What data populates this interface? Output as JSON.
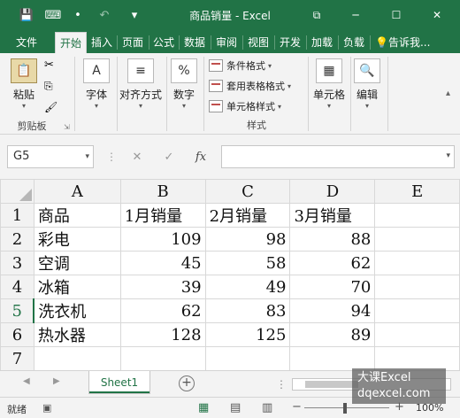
{
  "titlebar": {
    "title": "商品销量 - Excel",
    "save_icon": "💾",
    "touch_icon": "⌨",
    "dot": "•",
    "undo_icon": "↶",
    "customize_icon": "▾",
    "ribbon_display_icon": "⧉",
    "minimize_icon": "─",
    "restore_icon": "☐",
    "close_icon": "✕"
  },
  "tabs": [
    {
      "label": "文件"
    },
    {
      "label": "开始"
    },
    {
      "label": "插入"
    },
    {
      "label": "页面"
    },
    {
      "label": "公式"
    },
    {
      "label": "数据"
    },
    {
      "label": "审阅"
    },
    {
      "label": "视图"
    },
    {
      "label": "开发"
    },
    {
      "label": "加载"
    },
    {
      "label": "负载"
    },
    {
      "label": "告诉我..."
    }
  ],
  "ribbon": {
    "paste_label": "粘贴",
    "paste_caret": "▾",
    "clipboard_label": "剪贴板",
    "font_label": "字体",
    "alignment_label": "对齐方式",
    "number_label": "数字",
    "conditional_format_label": "条件格式",
    "table_format_label": "套用表格格式",
    "cell_style_label": "单元格样式",
    "styles_group_label": "样式",
    "cells_label": "单元格",
    "editing_label": "编辑",
    "dropdown_caret": "▾",
    "font_glyph": "A",
    "number_glyph": "%",
    "align_glyph": "≡"
  },
  "formula_bar": {
    "name_box": "G5",
    "cancel_glyph": "✕",
    "enter_glyph": "✓",
    "fx_glyph": "fx",
    "dropdown_caret": "▾",
    "formula_value": ""
  },
  "sheet": {
    "columns": [
      "A",
      "B",
      "C",
      "D",
      "E"
    ],
    "rows": [
      {
        "num": "1",
        "cells": [
          "商品",
          "1月销量",
          "2月销量",
          "3月销量",
          ""
        ]
      },
      {
        "num": "2",
        "cells": [
          "彩电",
          "109",
          "98",
          "88",
          ""
        ]
      },
      {
        "num": "3",
        "cells": [
          "空调",
          "45",
          "58",
          "62",
          ""
        ]
      },
      {
        "num": "4",
        "cells": [
          "冰箱",
          "39",
          "49",
          "70",
          ""
        ]
      },
      {
        "num": "5",
        "cells": [
          "洗衣机",
          "62",
          "83",
          "94",
          ""
        ]
      },
      {
        "num": "6",
        "cells": [
          "热水器",
          "128",
          "125",
          "89",
          ""
        ]
      },
      {
        "num": "7",
        "cells": [
          "",
          "",
          "",
          "",
          ""
        ]
      }
    ]
  },
  "sheet_tabs": {
    "active": "Sheet1",
    "add_glyph": "+",
    "prev_glyph": "◀",
    "next_glyph": "▶"
  },
  "status": {
    "ready": "就绪",
    "zoom": "100%",
    "zoom_minus": "−",
    "zoom_plus": "+"
  },
  "watermark": {
    "line1": "大课Excel",
    "line2": "dqexcel.com"
  },
  "colors": {
    "accent": "#217346",
    "ribbon_bg": "#f3f3f3",
    "grid_line": "#d8d8d8"
  }
}
